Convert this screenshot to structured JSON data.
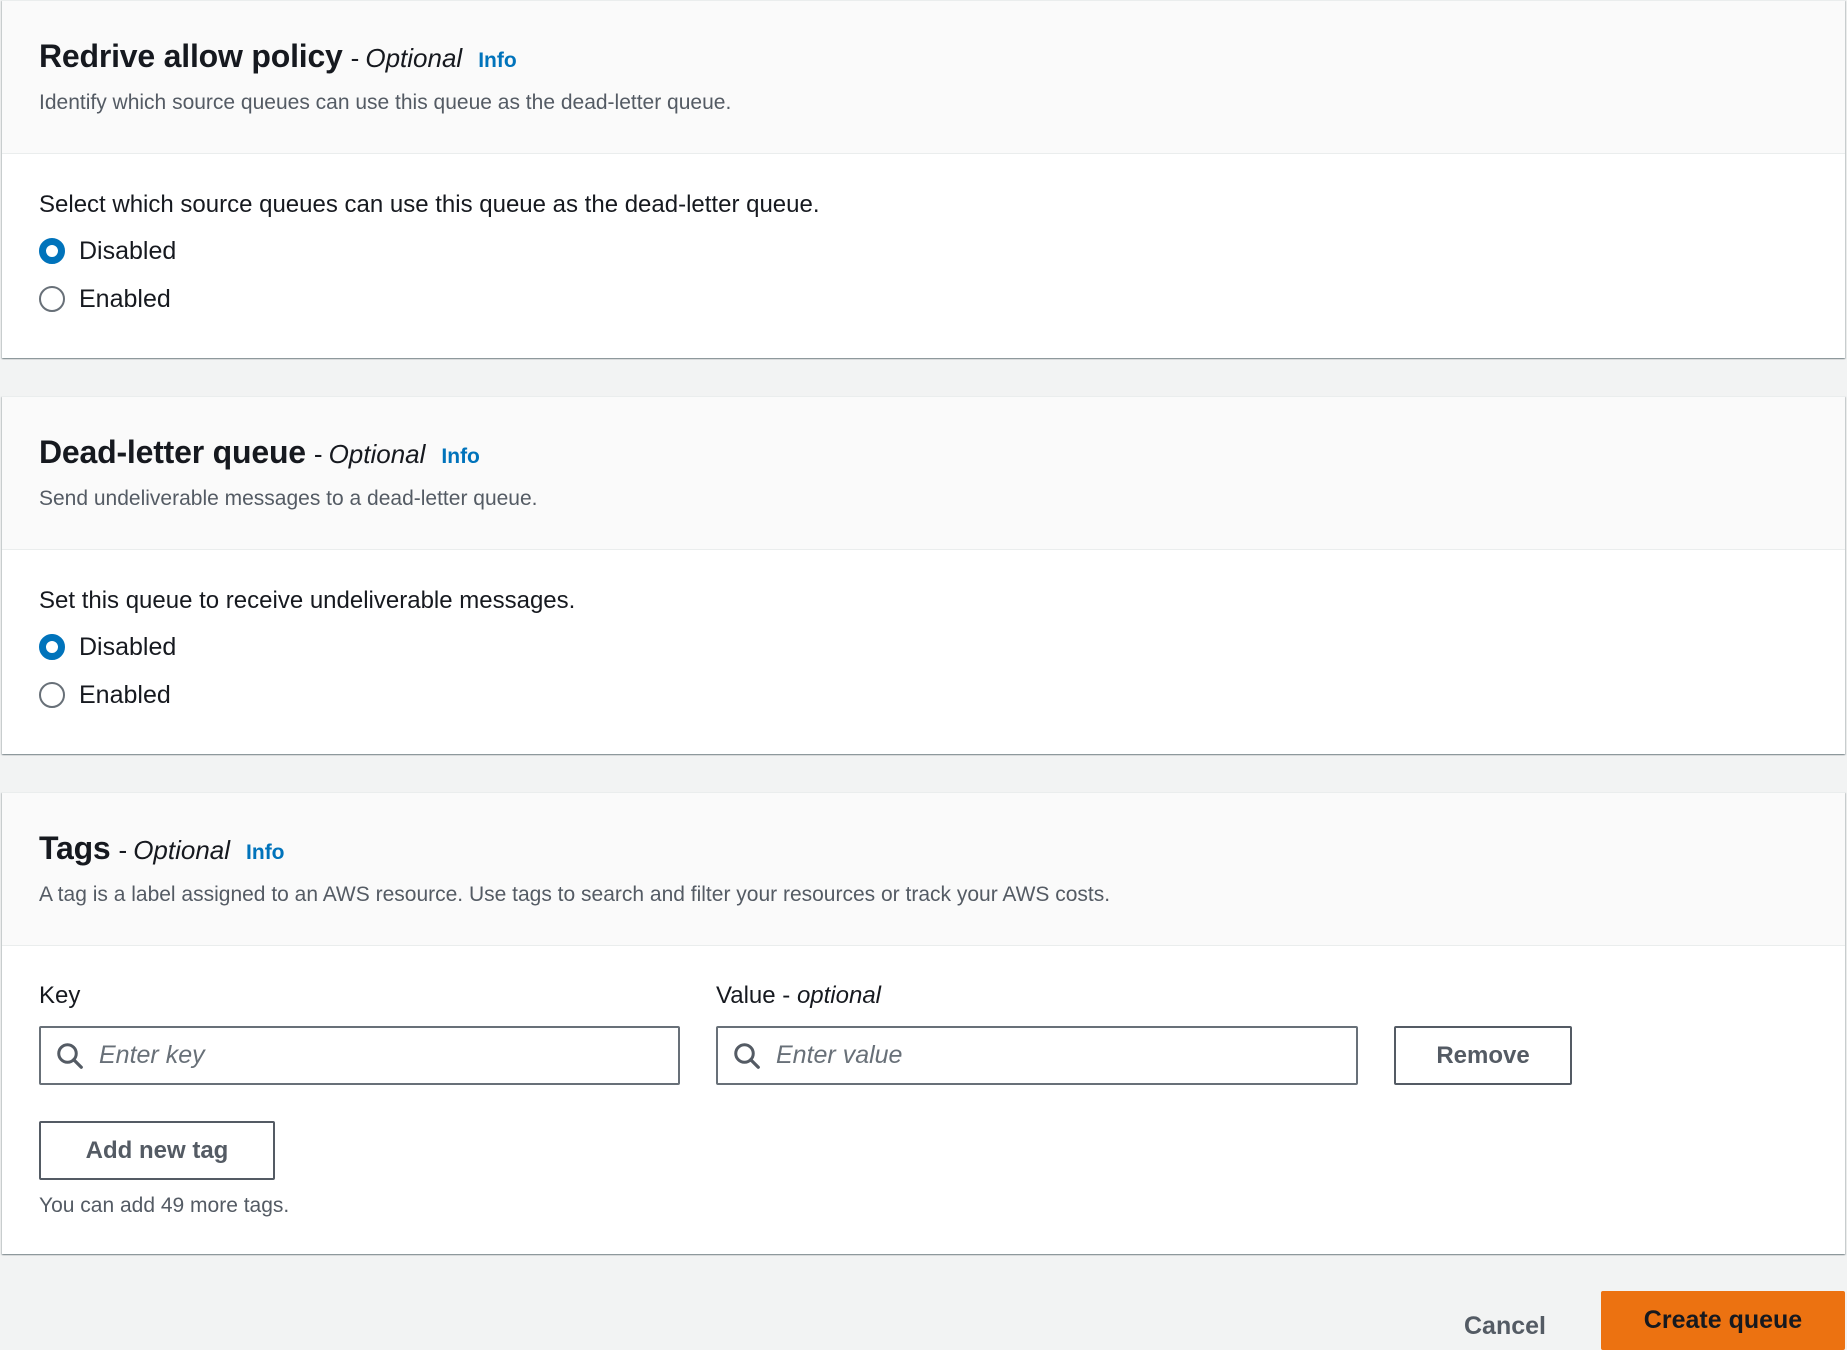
{
  "redrive_policy": {
    "title": "Redrive allow policy",
    "optional_dash": "-",
    "optional": "Optional",
    "info": "Info",
    "description": "Identify which source queues can use this queue as the dead-letter queue.",
    "field_label": "Select which source queues can use this queue as the dead-letter queue.",
    "options": [
      {
        "label": "Disabled",
        "checked": true
      },
      {
        "label": "Enabled",
        "checked": false
      }
    ]
  },
  "dead_letter": {
    "title": "Dead-letter queue",
    "optional_dash": "-",
    "optional": "Optional",
    "info": "Info",
    "description": "Send undeliverable messages to a dead-letter queue.",
    "field_label": "Set this queue to receive undeliverable messages.",
    "options": [
      {
        "label": "Disabled",
        "checked": true
      },
      {
        "label": "Enabled",
        "checked": false
      }
    ]
  },
  "tags": {
    "title": "Tags",
    "optional_dash": "-",
    "optional": "Optional",
    "info": "Info",
    "description": "A tag is a label assigned to an AWS resource. Use tags to search and filter your resources or track your AWS costs.",
    "key_label": "Key",
    "value_label_prefix": "Value -",
    "value_label_optional": "optional",
    "key_placeholder": "Enter key",
    "value_placeholder": "Enter value",
    "key_value": "",
    "value_value": "",
    "remove_label": "Remove",
    "add_label": "Add new tag",
    "hint": "You can add 49 more tags."
  },
  "footer": {
    "cancel_label": "Cancel",
    "create_label": "Create queue"
  },
  "colors": {
    "accent": "#0073bb",
    "primary_button": "#ec7211",
    "background": "#f2f3f3"
  }
}
